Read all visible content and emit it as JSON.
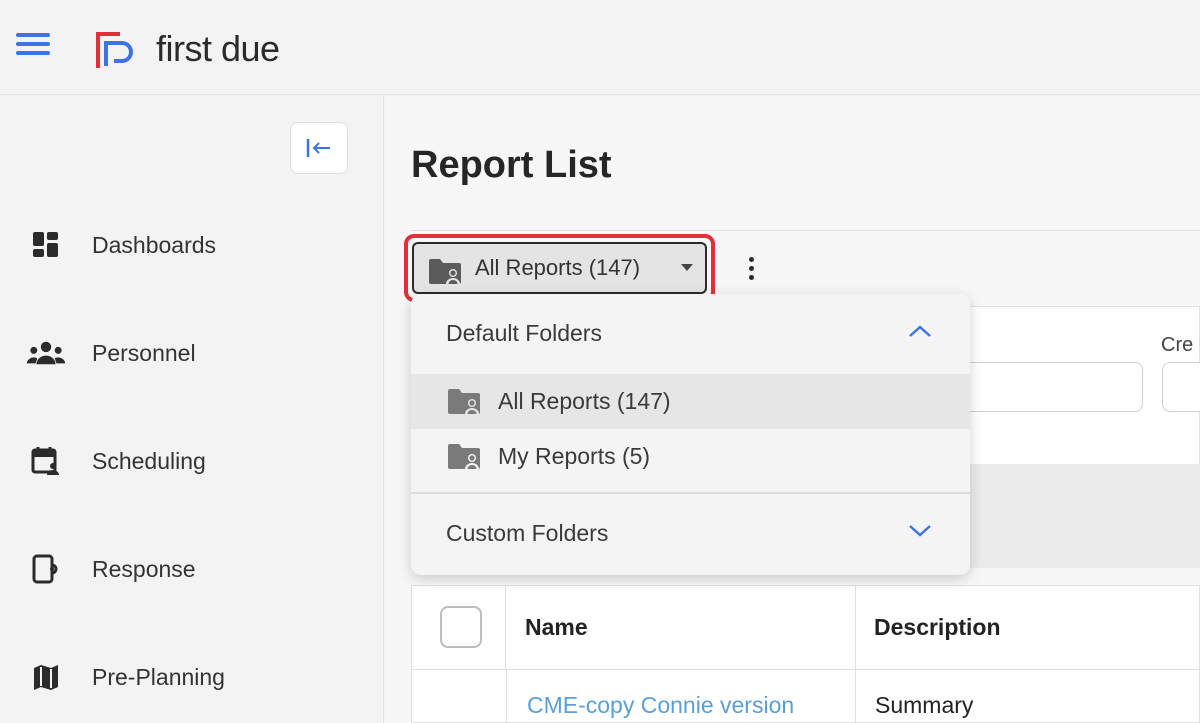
{
  "app": {
    "logo_text": "first due",
    "brand_colors": {
      "red": "#e0313b",
      "blue": "#3e73e6",
      "link": "#5a9fd6"
    }
  },
  "sidebar": {
    "items": [
      {
        "label": "Dashboards",
        "icon": "dashboard-icon"
      },
      {
        "label": "Personnel",
        "icon": "people-icon"
      },
      {
        "label": "Scheduling",
        "icon": "calendar-icon"
      },
      {
        "label": "Response",
        "icon": "response-icon"
      },
      {
        "label": "Pre-Planning",
        "icon": "map-icon"
      }
    ]
  },
  "main": {
    "title": "Report List",
    "folder_button_label": "All Reports (147)",
    "filter_label_partial": "Cre"
  },
  "dropdown": {
    "default_folders_label": "Default Folders",
    "items": [
      {
        "label": "All Reports (147)",
        "active": true
      },
      {
        "label": "My Reports (5)",
        "active": false
      }
    ],
    "custom_folders_label": "Custom Folders"
  },
  "table": {
    "columns": [
      "Name",
      "Description"
    ],
    "rows": [
      {
        "name": "CME-copy Connie version",
        "description": "Summary"
      }
    ]
  }
}
